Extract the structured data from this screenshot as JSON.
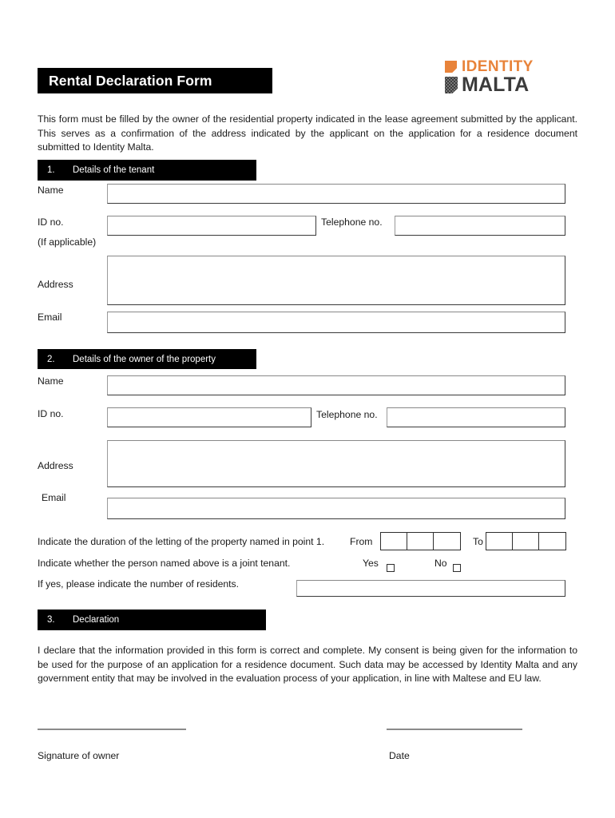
{
  "header": {
    "title": "Rental Declaration Form",
    "logo": {
      "line1": "IDENTITY",
      "line2": "MALTA",
      "accent_color": "#e8833a",
      "dark_color": "#3b3b3b"
    }
  },
  "intro": "This form must be filled by the owner of the residential property indicated in the lease agreement submitted by the applicant. This serves as a confirmation of the address indicated by the applicant on the application for a residence document submitted to Identity Malta.",
  "sections": {
    "tenant": {
      "number": "1.",
      "label": "Details  of the tenant",
      "fields": {
        "name_label": "Name",
        "name_value": "",
        "id_label": "ID no.",
        "id_value": "",
        "id_note": "(If applicable)",
        "telephone_label": "Telephone no.",
        "telephone_value": "",
        "address_label": "Address",
        "address_value": "",
        "email_label": "Email",
        "email_value": ""
      }
    },
    "owner": {
      "number": "2.",
      "label": "Details of the owner of the property",
      "fields": {
        "name_label": "Name",
        "name_value": "",
        "id_label": "ID no.",
        "id_value": "",
        "telephone_label": "Telephone no.",
        "telephone_value": "",
        "address_label": "Address",
        "address_value": "",
        "email_label": "Email",
        "email_value": ""
      }
    },
    "declaration": {
      "number": "3.",
      "label": "Declaration",
      "body": "I declare that the information provided in this form is correct and complete. My consent is being given for the information to be used for the purpose of an application for a residence document. Such data may be accessed by Identity Malta and any government entity that may be involved in the evaluation process of your application, in line with Maltese and EU law."
    }
  },
  "duration": {
    "question": "Indicate the duration of the letting of the property named in point 1.",
    "from_label": "From",
    "from_cells": [
      "",
      "",
      ""
    ],
    "to_label": "To",
    "to_cells": [
      "",
      "",
      ""
    ]
  },
  "joint_tenant": {
    "question": "Indicate whether the person named above is a joint tenant.",
    "yes_label": "Yes",
    "no_label": "No",
    "yes_checked": false,
    "no_checked": false
  },
  "residents": {
    "question": "If yes, please indicate the number of residents.",
    "value": ""
  },
  "signature": {
    "owner_label": "Signature of owner",
    "date_label": "Date"
  }
}
